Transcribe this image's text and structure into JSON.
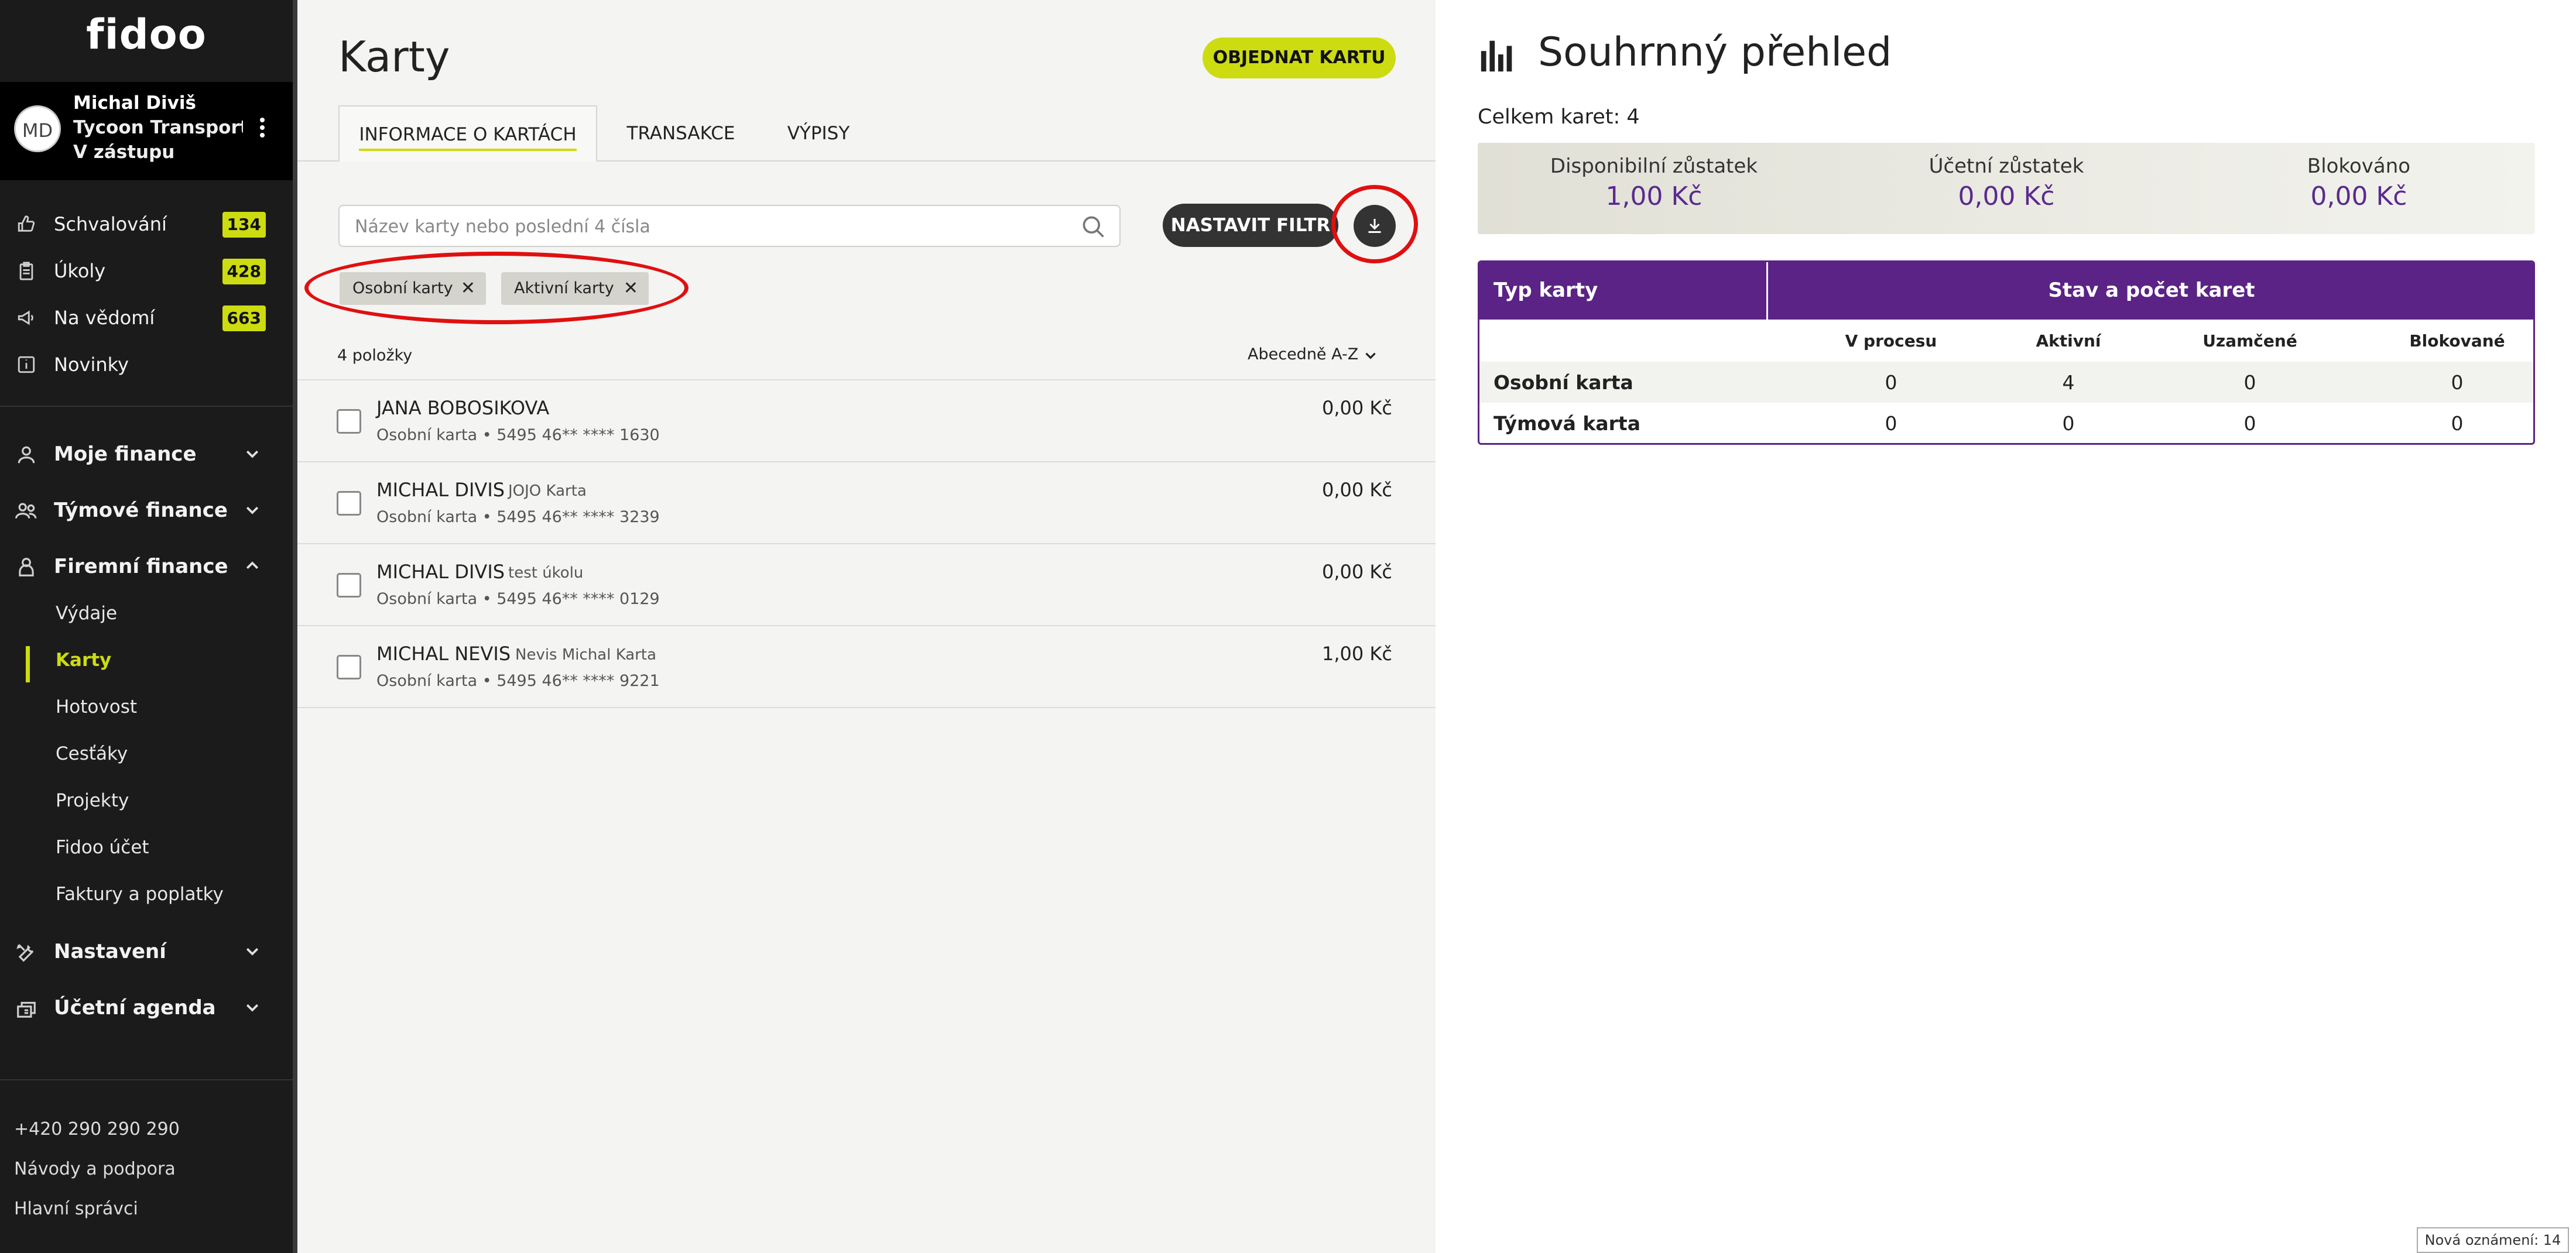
{
  "app": {
    "logo": "fidoo"
  },
  "user": {
    "initials": "MD",
    "name": "Michal Diviš",
    "company": "Tycoon Transport ...",
    "role": "V zástupu"
  },
  "nav": {
    "top": [
      {
        "label": "Schvalování",
        "badge": "134",
        "icon": "thumb-up-icon"
      },
      {
        "label": "Úkoly",
        "badge": "428",
        "icon": "clipboard-icon"
      },
      {
        "label": "Na vědomí",
        "badge": "663",
        "icon": "megaphone-icon"
      },
      {
        "label": "Novinky",
        "icon": "info-icon"
      }
    ],
    "sections": [
      {
        "label": "Moje finance",
        "icon": "user-icon"
      },
      {
        "label": "Týmové finance",
        "icon": "team-icon"
      },
      {
        "label": "Firemní finance",
        "icon": "company-icon"
      }
    ],
    "firemni_sub": [
      "Výdaje",
      "Karty",
      "Hotovost",
      "Cesťáky",
      "Projekty",
      "Fidoo účet",
      "Faktury a poplatky"
    ],
    "bottom_sections": [
      {
        "label": "Nastavení",
        "icon": "tools-icon"
      },
      {
        "label": "Účetní agenda",
        "icon": "accounting-icon"
      }
    ],
    "footer": [
      "+420 290 290 290",
      "Návody a podpora",
      "Hlavní správci"
    ]
  },
  "main": {
    "title": "Karty",
    "order_button": "OBJEDNAT KARTU",
    "tabs": [
      "INFORMACE O KARTÁCH",
      "TRANSAKCE",
      "VÝPISY"
    ],
    "search_placeholder": "Název karty nebo poslední 4 čísla",
    "filter_button": "NASTAVIT FILTR",
    "chips": [
      "Osobní karty",
      "Aktivní karty"
    ],
    "count": "4 položky",
    "sort": "Abecedně A-Z",
    "cards": [
      {
        "holder": "JANA BOBOSIKOVA",
        "alias": "",
        "meta": "Osobní karta •  5495 46** **** 1630",
        "amount": "0,00 Kč"
      },
      {
        "holder": "MICHAL DIVIS",
        "alias": "JOJO Karta",
        "meta": "Osobní karta •  5495 46** **** 3239",
        "amount": "0,00 Kč"
      },
      {
        "holder": "MICHAL DIVIS",
        "alias": "test úkolu",
        "meta": "Osobní karta •  5495 46** **** 0129",
        "amount": "0,00 Kč"
      },
      {
        "holder": "MICHAL NEVIS",
        "alias": "Nevis Michal Karta",
        "meta": "Osobní karta •  5495 46** **** 9221",
        "amount": "1,00 Kč"
      }
    ]
  },
  "summary": {
    "title": "Souhrnný přehled",
    "total": "Celkem karet: 4",
    "balances": [
      {
        "label": "Disponibilní zůstatek",
        "value": "1,00 Kč"
      },
      {
        "label": "Účetní zůstatek",
        "value": "0,00 Kč"
      },
      {
        "label": "Blokováno",
        "value": "0,00 Kč"
      }
    ],
    "table": {
      "col1": "Typ karty",
      "col2": "Stav a počet karet",
      "subcols": [
        "V procesu",
        "Aktivní",
        "Uzamčené",
        "Blokované"
      ],
      "rows": [
        {
          "name": "Osobní karta",
          "values": [
            "0",
            "4",
            "0",
            "0"
          ]
        },
        {
          "name": "Týmová karta",
          "values": [
            "0",
            "0",
            "0",
            "0"
          ]
        }
      ]
    }
  },
  "toast": "Nová oznámení: 14",
  "colors": {
    "accent": "#cddc10",
    "purple": "#5b2385",
    "highlight_ring": "#e01010",
    "sidebar_bg": "#1b1b1b"
  }
}
